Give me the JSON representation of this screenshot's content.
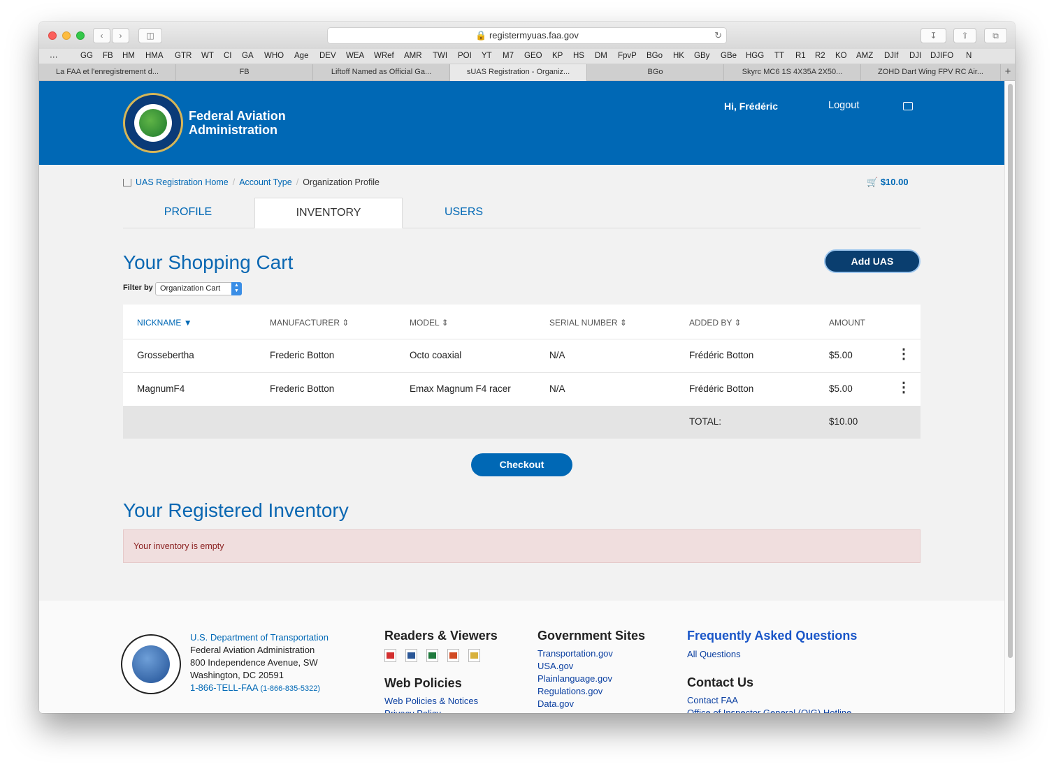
{
  "browser": {
    "url": "registermyuas.faa.gov",
    "bookmarks": [
      "GG",
      "FB",
      "HM",
      "HMA",
      "GTR",
      "WT",
      "CI",
      "GA",
      "WHO",
      "Age",
      "DEV",
      "WEA",
      "WRef",
      "AMR",
      "TWI",
      "POI",
      "YT",
      "M7",
      "GEO",
      "KP",
      "HS",
      "DM",
      "FpvP",
      "BGo",
      "HK",
      "GBy",
      "GBe",
      "HGG",
      "TT",
      "R1",
      "R2",
      "KO",
      "AMZ",
      "DJIf",
      "DJI",
      "DJIFO",
      "N"
    ],
    "tabs": [
      {
        "label": "La FAA et l'enregistrement d..."
      },
      {
        "label": "FB"
      },
      {
        "label": "Liftoff Named as Official Ga..."
      },
      {
        "label": "sUAS Registration - Organiz..."
      },
      {
        "label": "BGo"
      },
      {
        "label": "Skyrc MC6 1S 4X35A 2X50..."
      },
      {
        "label": "ZOHD Dart Wing FPV RC Air..."
      }
    ],
    "active_tab": 3
  },
  "header": {
    "agency_line1": "Federal Aviation",
    "agency_line2": "Administration",
    "greeting": "Hi, Frédéric",
    "logout": "Logout"
  },
  "breadcrumb": {
    "home": "UAS Registration Home",
    "account": "Account Type",
    "current": "Organization Profile"
  },
  "cart_total_badge": "$10.00",
  "page_tabs": {
    "profile": "PROFILE",
    "inventory": "INVENTORY",
    "users": "USERS",
    "active": "inventory"
  },
  "shopping_cart": {
    "title": "Your Shopping Cart",
    "add_button": "Add UAS",
    "filter_label": "Filter by",
    "filter_value": "Organization Cart",
    "columns": {
      "nickname": "NICKNAME",
      "manufacturer": "MANUFACTURER",
      "model": "MODEL",
      "serial": "SERIAL NUMBER",
      "added_by": "ADDED BY",
      "amount": "AMOUNT"
    },
    "rows": [
      {
        "nickname": "Grossebertha",
        "manufacturer": "Frederic Botton",
        "model": "Octo coaxial",
        "serial": "N/A",
        "added_by": "Frédéric Botton",
        "amount": "$5.00"
      },
      {
        "nickname": "MagnumF4",
        "manufacturer": "Frederic Botton",
        "model": "Emax Magnum F4 racer",
        "serial": "N/A",
        "added_by": "Frédéric Botton",
        "amount": "$5.00"
      }
    ],
    "total_label": "TOTAL:",
    "total_value": "$10.00",
    "checkout": "Checkout"
  },
  "registered_inventory": {
    "title": "Your Registered Inventory",
    "empty_message": "Your inventory is empty"
  },
  "footer": {
    "dot_link": "U.S. Department of Transportation",
    "address": [
      "Federal Aviation Administration",
      "800 Independence Avenue, SW",
      "Washington, DC 20591"
    ],
    "phone": "1-866-TELL-FAA",
    "phone_alt": "(1-866-835-5322)",
    "readers_title": "Readers & Viewers",
    "web_policies_title": "Web Policies",
    "web_policies_links": [
      "Web Policies & Notices",
      "Privacy Policy"
    ],
    "gov_sites_title": "Government Sites",
    "gov_sites": [
      "Transportation.gov",
      "USA.gov",
      "Plainlanguage.gov",
      "Regulations.gov",
      "Data.gov"
    ],
    "faq_title": "Frequently Asked Questions",
    "faq_link": "All Questions",
    "contact_title": "Contact Us",
    "contact_links": [
      "Contact FAA",
      "Office of Inspector General (OIG) Hotline"
    ]
  },
  "colors": {
    "brand_blue": "#0068b5",
    "dark_button": "#0a3e6f",
    "alert_bg": "#f0dede"
  }
}
